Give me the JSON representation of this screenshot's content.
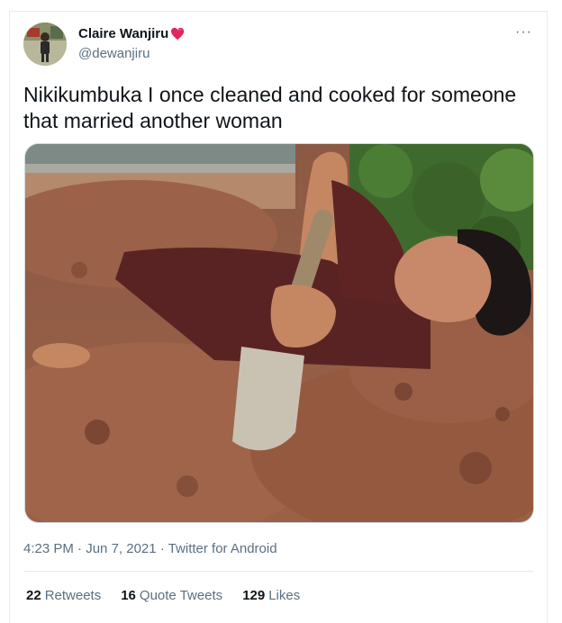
{
  "tweet": {
    "display_name": "Claire Wanjiru",
    "handle": "@dewanjiru",
    "text": "Nikikumbuka I once cleaned and cooked for someone that married another woman",
    "time": "4:23 PM",
    "date": "Jun 7, 2021",
    "source": "Twitter for Android",
    "more_glyph": "···",
    "separator": " · "
  },
  "stats": {
    "retweets": "22",
    "retweets_label": "Retweets",
    "quote_tweets": "16",
    "quote_tweets_label": "Quote Tweets",
    "likes": "129",
    "likes_label": "Likes"
  },
  "colors": {
    "heart": "#e0245e",
    "secondary_text": "#5b7083",
    "border": "#e6ecf0"
  },
  "icons": [
    "heart-emoji-icon",
    "more-options-icon"
  ]
}
